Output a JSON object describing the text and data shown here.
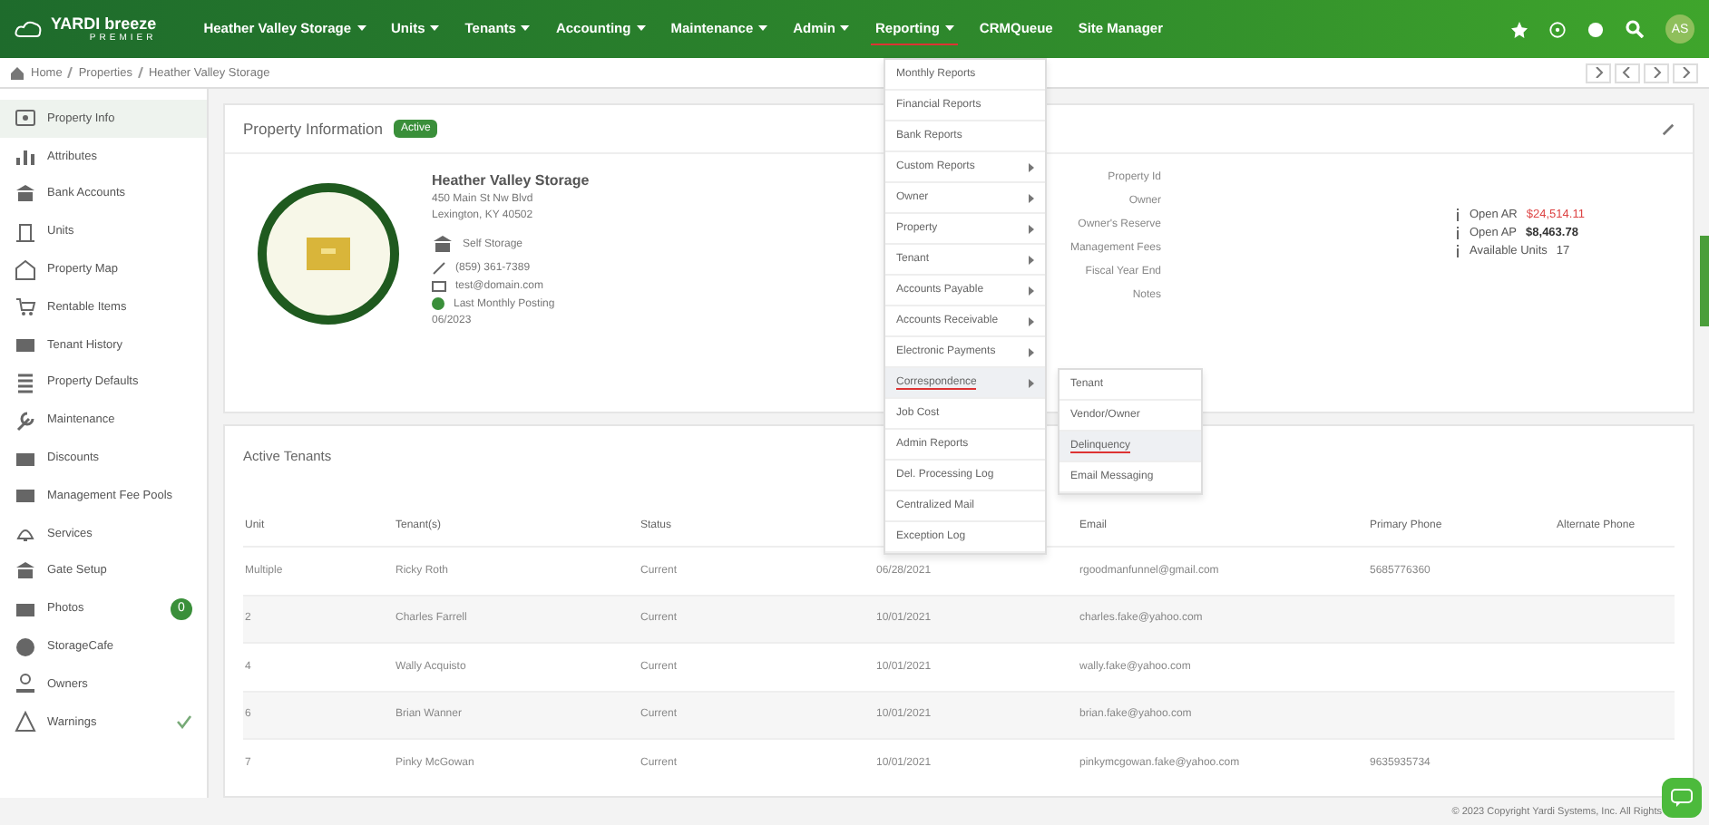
{
  "nav": {
    "logo": "YARDI breeze",
    "logo_sub": "PREMIER",
    "items": [
      {
        "label": "Heather Valley Storage",
        "dropdown": true,
        "selected": false
      },
      {
        "label": "Units",
        "dropdown": true,
        "selected": false
      },
      {
        "label": "Tenants",
        "dropdown": true,
        "selected": false
      },
      {
        "label": "Accounting",
        "dropdown": true,
        "selected": false
      },
      {
        "label": "Maintenance",
        "dropdown": true,
        "selected": false
      },
      {
        "label": "Admin",
        "dropdown": true,
        "selected": false
      },
      {
        "label": "Reporting",
        "dropdown": true,
        "selected": true
      },
      {
        "label": "CRMQueue",
        "dropdown": false,
        "selected": false
      },
      {
        "label": "Site Manager",
        "dropdown": false,
        "selected": false
      }
    ],
    "avatar": "AS"
  },
  "breadcrumb": [
    "Home",
    "Properties",
    "Heather Valley Storage"
  ],
  "sidebar": {
    "items": [
      {
        "label": "Property Info",
        "selected": true
      },
      {
        "label": "Attributes",
        "selected": false
      },
      {
        "label": "Bank Accounts",
        "selected": false
      },
      {
        "label": "Units",
        "selected": false
      },
      {
        "label": "Property Map",
        "selected": false
      },
      {
        "label": "Rentable Items",
        "selected": false
      },
      {
        "label": "Tenant History",
        "selected": false
      },
      {
        "label": "Property Defaults",
        "selected": false
      },
      {
        "label": "Maintenance",
        "selected": false
      },
      {
        "label": "Discounts",
        "selected": false
      },
      {
        "label": "Management Fee Pools",
        "selected": false
      },
      {
        "label": "Services",
        "selected": false
      },
      {
        "label": "Gate Setup",
        "selected": false
      },
      {
        "label": "Photos",
        "selected": false,
        "badge": "0"
      },
      {
        "label": "StorageCafe",
        "selected": false
      },
      {
        "label": "Owners",
        "selected": false
      },
      {
        "label": "Warnings",
        "selected": false,
        "checked": true
      }
    ]
  },
  "property_info": {
    "title": "Property Information",
    "status": "Active",
    "name": "Heather Valley Storage",
    "address": [
      "450 Main St Nw Blvd",
      "Lexington, KY 40502"
    ],
    "type": "Self Storage",
    "phone": "(859) 361-7389",
    "email": "test@domain.com",
    "posting": "Last Monthly Posting",
    "posting_date": "06/2023",
    "fields": [
      "Property Id",
      "Owner",
      "Owner's Reserve",
      "Management Fees",
      "Fiscal Year End",
      "Notes"
    ],
    "stats": [
      {
        "label": "Open AR",
        "value": "$24,514.11",
        "kind": "alert"
      },
      {
        "label": "Open AP",
        "value": "$8,463.78",
        "kind": "bold"
      },
      {
        "label": "Available Units",
        "value": "17",
        "kind": "plain"
      }
    ]
  },
  "active_tenants": {
    "title": "Active Tenants",
    "columns": [
      "Unit",
      "Tenant(s)",
      "Status",
      "",
      "Email",
      "Primary Phone",
      "Alternate Phone"
    ],
    "rows": [
      [
        "Multiple",
        "Ricky Roth",
        "Current",
        "06/28/2021",
        "rgoodmanfunnel@gmail.com",
        "5685776360",
        ""
      ],
      [
        "2",
        "Charles Farrell",
        "Current",
        "10/01/2021",
        "charles.fake@yahoo.com",
        "",
        ""
      ],
      [
        "4",
        "Wally Acquisto",
        "Current",
        "10/01/2021",
        "wally.fake@yahoo.com",
        "",
        ""
      ],
      [
        "6",
        "Brian Wanner",
        "Current",
        "10/01/2021",
        "brian.fake@yahoo.com",
        "",
        ""
      ],
      [
        "7",
        "Pinky McGowan",
        "Current",
        "10/01/2021",
        "pinkymcgowan.fake@yahoo.com",
        "9635935734",
        ""
      ]
    ]
  },
  "reporting_menu": {
    "items": [
      {
        "label": "Monthly Reports",
        "submenu": false,
        "selected": false
      },
      {
        "label": "Financial Reports",
        "submenu": false,
        "selected": false
      },
      {
        "label": "Bank Reports",
        "submenu": false,
        "selected": false
      },
      {
        "label": "Custom Reports",
        "submenu": true,
        "selected": false
      },
      {
        "label": "Owner",
        "submenu": true,
        "selected": false
      },
      {
        "label": "Property",
        "submenu": true,
        "selected": false
      },
      {
        "label": "Tenant",
        "submenu": true,
        "selected": false
      },
      {
        "label": "Accounts Payable",
        "submenu": true,
        "selected": false
      },
      {
        "label": "Accounts Receivable",
        "submenu": true,
        "selected": false
      },
      {
        "label": "Electronic Payments",
        "submenu": true,
        "selected": false
      },
      {
        "label": "Correspondence",
        "submenu": true,
        "selected": true
      },
      {
        "label": "Job Cost",
        "submenu": false,
        "selected": false
      },
      {
        "label": "Admin Reports",
        "submenu": false,
        "selected": false
      },
      {
        "label": "Del. Processing Log",
        "submenu": false,
        "selected": false
      },
      {
        "label": "Centralized Mail",
        "submenu": false,
        "selected": false
      },
      {
        "label": "Exception Log",
        "submenu": false,
        "selected": false
      }
    ],
    "submenu": [
      {
        "label": "Tenant",
        "selected": false
      },
      {
        "label": "Vendor/Owner",
        "selected": false
      },
      {
        "label": "Delinquency",
        "selected": true
      },
      {
        "label": "Email Messaging",
        "selected": false
      }
    ]
  },
  "footer": "© 2023 Copyright Yardi Systems, Inc. All Rights"
}
